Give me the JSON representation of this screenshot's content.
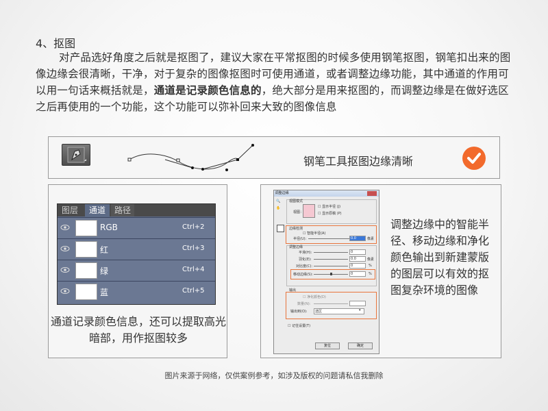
{
  "heading": "4、抠图",
  "paragraph": {
    "part1": "对产品选好角度之后就是抠图了，建议大家在平常抠图的时候多使用钢笔抠图，钢笔扣出来的图像边缘会很清晰，干净，对于复杂的图像抠图时可使用通道，或者调整边缘功能，其中通道的作用可以用一句话来概括就是，",
    "bold": "通道是记录颜色信息的",
    "part2": "，绝大部分是用来抠图的，而调整边缘是在做好选区之后再使用的一个功能，这个功能可以弥补回来大致的图像信息"
  },
  "pen_section": {
    "caption": "钢笔工具抠图边缘清晰",
    "tool_icon": "pen-tool-icon",
    "badge_icon": "checkmark-icon",
    "badge_color": "#f26a2c"
  },
  "channels_section": {
    "tabs": [
      "图层",
      "通道",
      "路径"
    ],
    "active_tab": "通道",
    "rows": [
      {
        "name": "RGB",
        "shortcut": "Ctrl+2"
      },
      {
        "name": "红",
        "shortcut": "Ctrl+3"
      },
      {
        "name": "绿",
        "shortcut": "Ctrl+4"
      },
      {
        "name": "蓝",
        "shortcut": "Ctrl+5"
      }
    ],
    "caption": "通道记录颜色信息，还可以提取高光暗部，用作抠图较多"
  },
  "refine_section": {
    "dialog": {
      "title": "调整边缘",
      "view_mode_label": "视图模式",
      "view_label": "视图：",
      "show_radius": "显示半径 (J)",
      "show_original": "显示原稿 (P)",
      "edge_detection_label": "边缘检测",
      "smart_radius": "智能半径(A)",
      "radius_label": "半径(U):",
      "radius_value": "0.0",
      "radius_unit": "像素",
      "adjust_edge_label": "调整边缘",
      "smooth_label": "平滑(H):",
      "smooth_value": "0",
      "feather_label": "羽化(E):",
      "feather_value": "0.0",
      "feather_unit": "像素",
      "contrast_label": "对比度(C):",
      "contrast_value": "0",
      "shift_edge_label": "移动边缘(S):",
      "shift_edge_value": "0",
      "percent": "%",
      "output_label": "输出",
      "decontaminate": "净化颜色(D)",
      "amount_label": "数量(N):",
      "output_to_label": "输出到(O):",
      "output_to_value": "选区",
      "remember": "记住设置(T)",
      "cancel": "复位",
      "ok": "确定"
    },
    "caption": "调整边缘中的智能半径、移动边缘和净化颜色输出到新建蒙版的图层可以有效的抠图复杂环境的图像"
  },
  "footer": "图片来源于网络，仅供案例参考，如涉及版权的问题请私信我删除",
  "colors": {
    "accent": "#f26a2c",
    "panel": "#5d6b86",
    "highlight_border": "#e8743b"
  }
}
